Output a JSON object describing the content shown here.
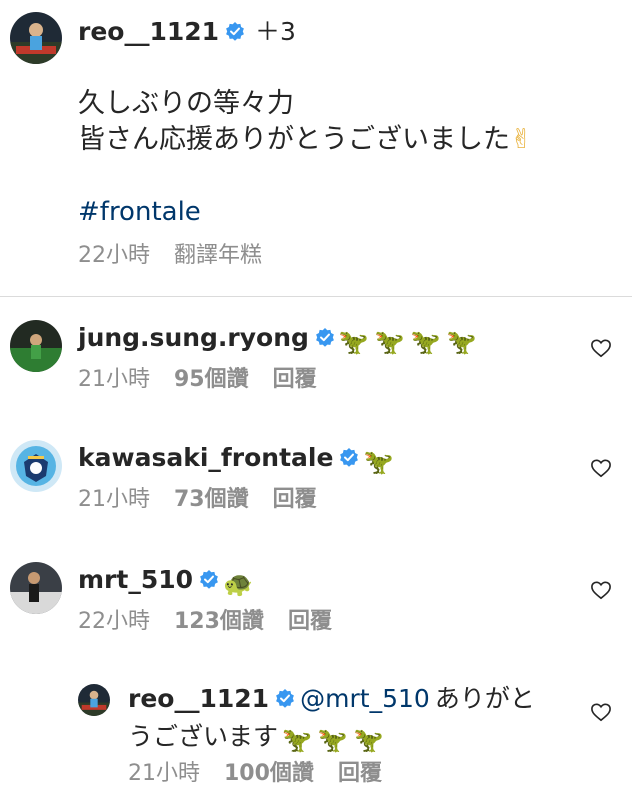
{
  "post": {
    "username": "reo__1121",
    "coauthors": "＋3",
    "caption_line1": "久しぶりの等々力",
    "caption_line2": "皆さん応援ありがとうございました",
    "caption_emoji": "✌",
    "hashtag": "#frontale",
    "time": "22小時",
    "translate": "翻譯年糕"
  },
  "comments": [
    {
      "username": "jung.sung.ryong",
      "emoji": "🦖🦖🦖🦖",
      "time": "21小時",
      "likes": "95個讚",
      "reply": "回覆"
    },
    {
      "username": "kawasaki_frontale",
      "emoji": "🦖",
      "time": "21小時",
      "likes": "73個讚",
      "reply": "回覆"
    },
    {
      "username": "mrt_510",
      "emoji": "🐢",
      "time": "22小時",
      "likes": "123個讚",
      "reply": "回覆"
    }
  ],
  "reply_comment": {
    "username": "reo__1121",
    "mention": "@mrt_510",
    "text_part1": "ありがと",
    "text_part2": "うございます",
    "emoji": "🦖🦖🦖",
    "time": "21小時",
    "likes": "100個讚",
    "reply": "回覆"
  },
  "icons": {
    "verified": "verified-badge-icon",
    "heart": "heart-outline-icon"
  },
  "colors": {
    "verified_blue": "#3897f0",
    "meta_gray": "#8e8e8e",
    "link_blue": "#00376b"
  }
}
